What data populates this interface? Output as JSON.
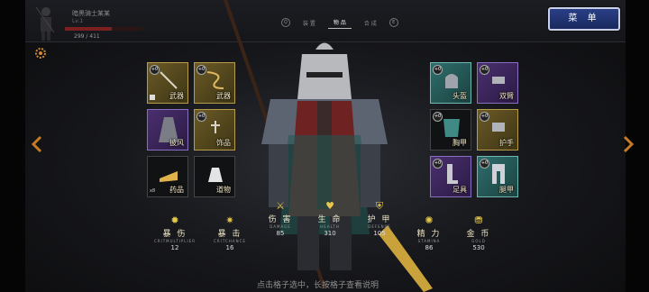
{
  "player": {
    "name": "暗黑骑士某某",
    "sub": "Lv.1",
    "hp": "299 / 411",
    "hp_fraction": 0.6
  },
  "tabs": [
    {
      "icon": "Q",
      "label": ""
    },
    {
      "label": "装 置"
    },
    {
      "label": "物 品",
      "active": true
    },
    {
      "label": "合 成"
    },
    {
      "icon": "E",
      "label": ""
    }
  ],
  "menu_button": "菜 单",
  "left_slots": [
    {
      "label": "武器",
      "rarity": "gold",
      "plus": "+0"
    },
    {
      "label": "武器",
      "rarity": "gold",
      "plus": "+0"
    },
    {
      "label": "披风",
      "rarity": "purple",
      "plus": ""
    },
    {
      "label": "饰品",
      "rarity": "gold",
      "plus": "+0"
    },
    {
      "label": "药品",
      "rarity": "dark",
      "plus": "",
      "count": "x8"
    },
    {
      "label": "道物",
      "rarity": "dark",
      "plus": ""
    }
  ],
  "right_slots": [
    {
      "label": "头盔",
      "rarity": "teal",
      "plus": "+0"
    },
    {
      "label": "双臂",
      "rarity": "purple",
      "plus": "+0"
    },
    {
      "label": "胸甲",
      "rarity": "dark",
      "plus": "+0"
    },
    {
      "label": "护手",
      "rarity": "gold",
      "plus": "+0"
    },
    {
      "label": "足具",
      "rarity": "purple",
      "plus": "+0"
    },
    {
      "label": "腿甲",
      "rarity": "teal",
      "plus": "+0"
    }
  ],
  "stats": [
    {
      "name": "暴 伤",
      "en": "CRITMULTIPLIER",
      "value": "12"
    },
    {
      "name": "暴 击",
      "en": "CRITCHANCE",
      "value": "16"
    },
    {
      "name": "伤 害",
      "en": "DAMAGE",
      "value": "85"
    },
    {
      "name": "生 命",
      "en": "HEALTH",
      "value": "310"
    },
    {
      "name": "护 甲",
      "en": "DEFENSE",
      "value": "105"
    },
    {
      "name": "精 力",
      "en": "STAMINA",
      "value": "86"
    },
    {
      "name": "金 币",
      "en": "GOLD",
      "value": "530"
    }
  ],
  "hint": "点击格子选中，长按格子查看说明",
  "colors": {
    "gold": "#b89c4a",
    "purple": "#8a6fbf",
    "teal": "#6fb7b3",
    "accent": "#e7c84a",
    "menu": "#2a3f86"
  }
}
